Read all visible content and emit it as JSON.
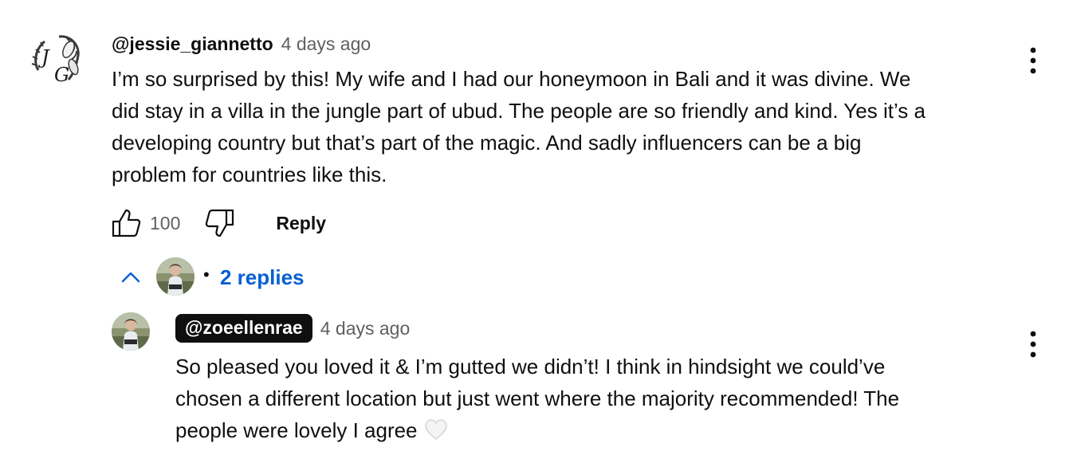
{
  "comment": {
    "author": "@jessie_giannetto",
    "timestamp": "4 days ago",
    "text": "I’m so surprised by this! My wife and I had our honeymoon in Bali and it was divine. We\ndid stay in a villa in the jungle part of ubud. The people are so friendly and kind. Yes it’s a\ndeveloping country but that’s part of the magic. And sadly influencers can be a big\nproblem for countries like this.",
    "avatar_icon": "jg-monogram-avatar",
    "like_count": "100",
    "reply_label": "Reply",
    "menu_icon": "more-vert-icon"
  },
  "replies": {
    "count_label": "2 replies",
    "separator": "•",
    "expanded": true,
    "toggle_icon": "chevron-up-icon"
  },
  "reply": {
    "author": "@zoeellenrae",
    "is_creator": true,
    "timestamp": "4 days ago",
    "text": "So pleased you loved it & I’m gutted we didn’t! I think in hindsight we could’ve\nchosen a different location but just went where the majority recommended! The\npeople were lovely I agree",
    "emoji": "white-heart-icon",
    "menu_icon": "more-vert-icon"
  },
  "colors": {
    "text": "#0f0f0f",
    "secondary_text": "#606060",
    "link_blue": "#065fd4",
    "creator_badge_bg": "#0f0f0f",
    "background": "#ffffff"
  }
}
